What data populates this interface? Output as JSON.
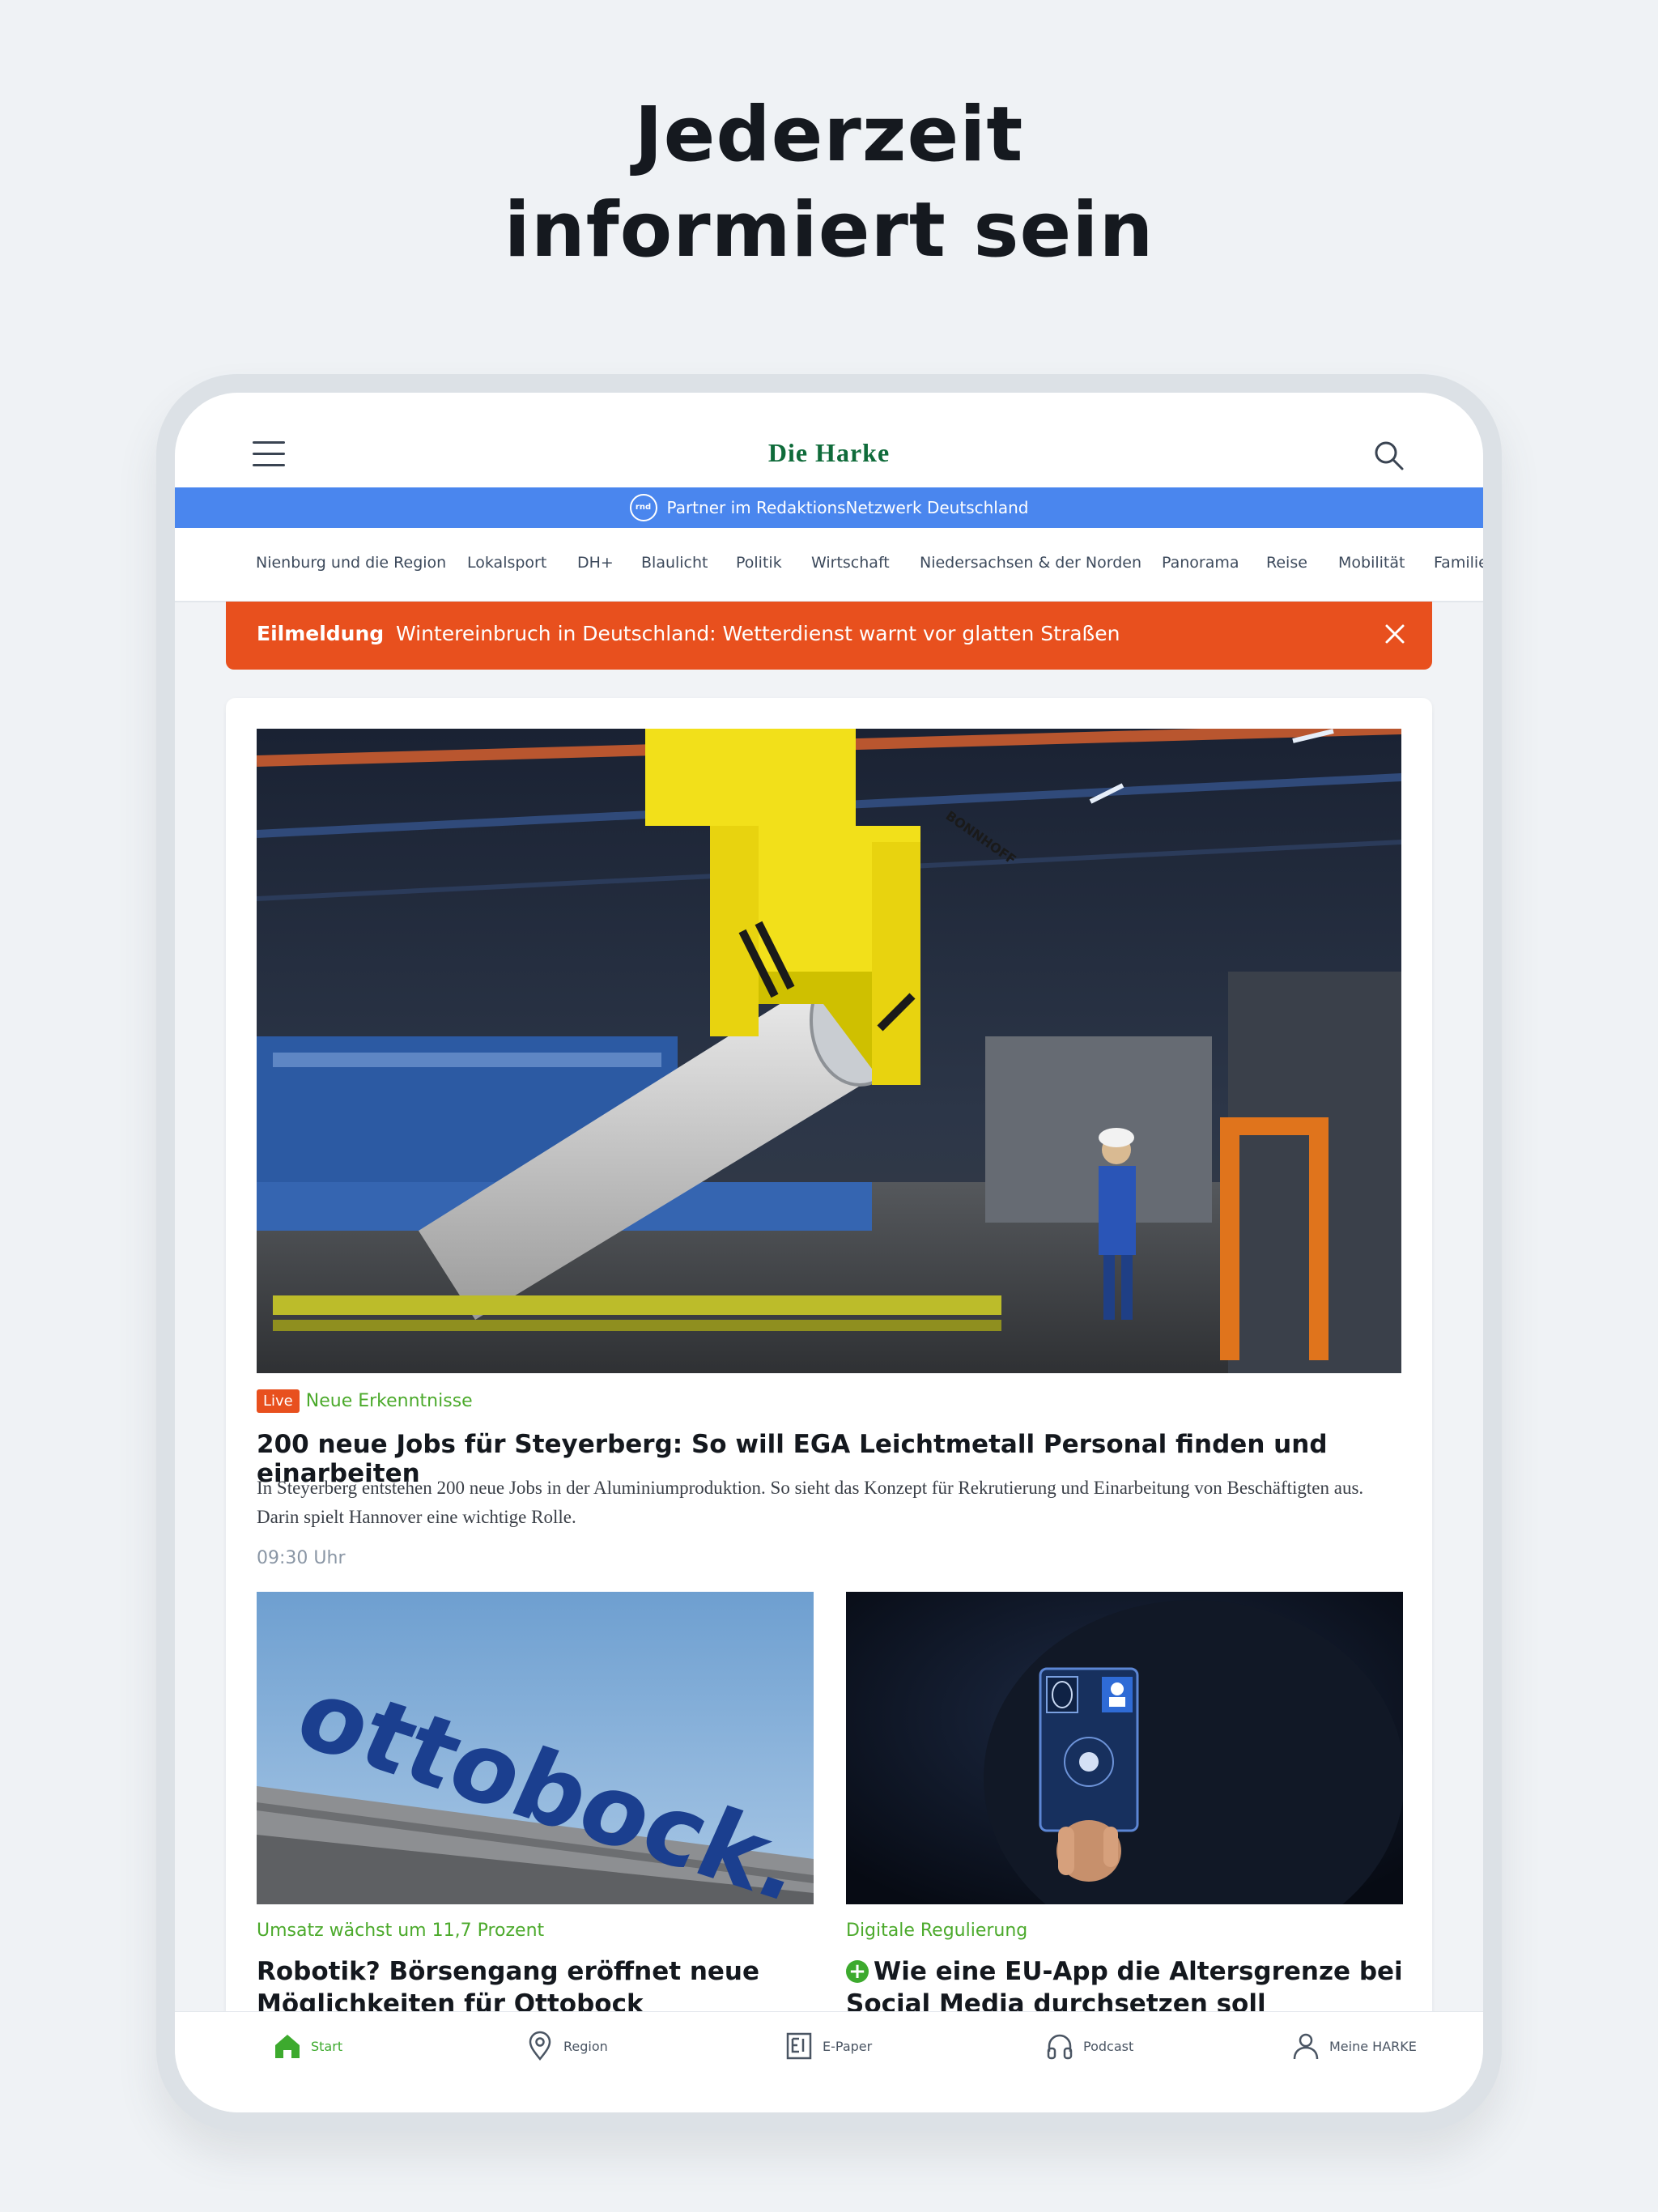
{
  "promo": {
    "headline_line1": "Jederzeit",
    "headline_line2": "informiert sein"
  },
  "app": {
    "logo": "Die Harke",
    "partner_banner": "Partner im RedaktionsNetzwerk Deutschland",
    "partner_badge": "rnd"
  },
  "nav": {
    "items": [
      "Nienburg und die Region",
      "Lokalsport",
      "DH+",
      "Blaulicht",
      "Politik",
      "Wirtschaft",
      "Niedersachsen & der Norden",
      "Panorama",
      "Reise",
      "Mobilität",
      "Familie"
    ]
  },
  "breaking": {
    "label": "Eilmeldung",
    "text": "Wintereinbruch in Deutschland: Wetterdienst warnt vor glatten Straßen"
  },
  "hero": {
    "live_badge": "Live",
    "kicker": "Neue Erkenntnisse",
    "title": "200 neue Jobs für Steyerberg: So will EGA Leichtmetall Personal finden und einarbeiten",
    "teaser": "In Steyerberg entstehen 200 neue Jobs in der Aluminiumproduktion. So sieht das Konzept für Rekrutierung und Einarbeitung von Beschäftigten aus. Darin spielt Hannover eine wichtige Rolle.",
    "time": "09:30 Uhr",
    "crane_text": "BONNHOFF"
  },
  "articles": [
    {
      "kicker": "Umsatz wächst um 11,7 Prozent",
      "title": "Robotik? Börsengang eröffnet neue Möglichkeiten für Ottobock",
      "image_text": "ottobock."
    },
    {
      "kicker": "Digitale Regulierung",
      "title": "Wie eine EU-App die Altersgrenze bei Social Media durchsetzen soll",
      "plus": "+"
    }
  ],
  "tabbar": {
    "items": [
      {
        "label": "Start",
        "icon": "home-icon"
      },
      {
        "label": "Region",
        "icon": "location-pin-icon"
      },
      {
        "label": "E-Paper",
        "icon": "epaper-icon"
      },
      {
        "label": "Podcast",
        "icon": "headphones-icon"
      },
      {
        "label": "Meine HARKE",
        "icon": "user-icon"
      }
    ]
  },
  "colors": {
    "brand_green": "#0f6b3a",
    "accent_green": "#4caa2c",
    "breaking_orange": "#e8501e",
    "rnd_blue": "#4a86ee",
    "background": "#eff2f5"
  }
}
